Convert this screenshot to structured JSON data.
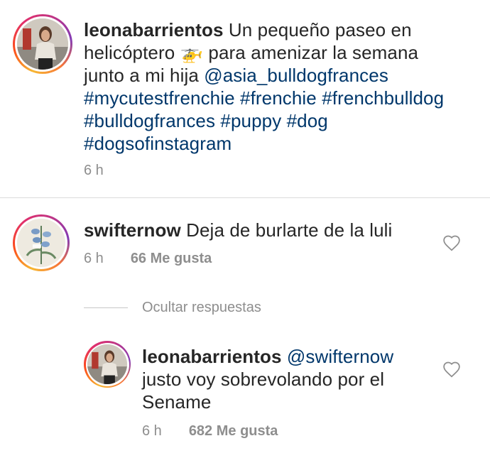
{
  "caption": {
    "username": "leonabarrientos",
    "text_1": "Un pequeño paseo en helicóptero ",
    "emoji": "🚁",
    "text_2": " para amenizar la semana junto a mi hija ",
    "mention": "@asia_bulldogfrances",
    "hashtags": "#mycutestfrenchie #frenchie #frenchbulldog #bulldogfrances #puppy #dog #dogsofinstagram",
    "time": "6 h"
  },
  "comment": {
    "username": "swifternow",
    "text": "Deja de burlarte de la luli",
    "time": "6 h",
    "likes": "66 Me gusta"
  },
  "hide_replies_label": "Ocultar respuestas",
  "reply": {
    "username": "leonabarrientos",
    "mention": "@swifternow",
    "text": "justo voy sobrevolando por el Sename",
    "time": "6 h",
    "likes": "682 Me gusta"
  },
  "colors": {
    "link": "#00376b",
    "secondary": "#8e8e8e",
    "divider": "#dbdbdb"
  },
  "icons": {
    "like": "heart-outline-icon",
    "helicopter": "helicopter-emoji"
  }
}
